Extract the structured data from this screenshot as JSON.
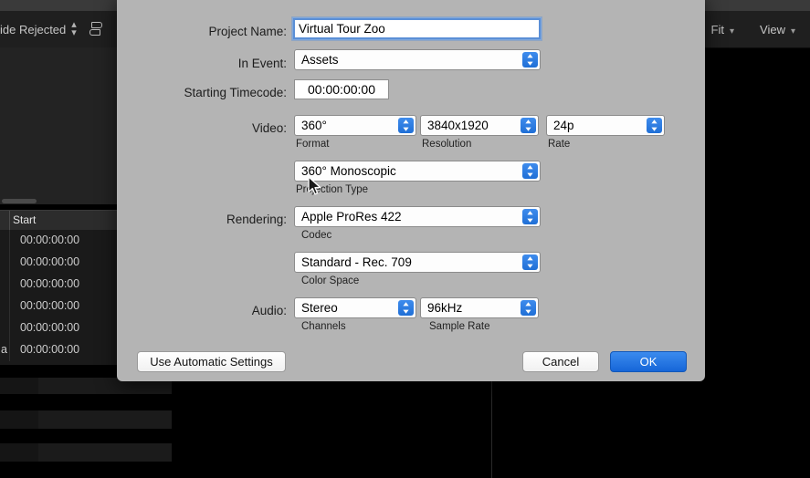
{
  "background": {
    "toolbar": {
      "hide_rejected_label": "ide Rejected",
      "stepper_icon": "stepper-updown-icon",
      "group_icon": "group-clips-icon",
      "fit_label": "Fit",
      "view_label": "View",
      "chevron_icon": "chevron-down-icon"
    },
    "event_list": {
      "column_header": "Start",
      "rows": [
        {
          "prefix": "",
          "start": "00:00:00:00"
        },
        {
          "prefix": "",
          "start": "00:00:00:00"
        },
        {
          "prefix": "",
          "start": "00:00:00:00"
        },
        {
          "prefix": "",
          "start": "00:00:00:00"
        },
        {
          "prefix": "",
          "start": "00:00:00:00"
        },
        {
          "prefix": "a",
          "start": "00:00:00:00"
        }
      ]
    }
  },
  "dialog": {
    "project_name": {
      "label": "Project Name:",
      "value": "Virtual Tour Zoo"
    },
    "in_event": {
      "label": "In Event:",
      "value": "Assets"
    },
    "starting_timecode": {
      "label": "Starting Timecode:",
      "value": "00:00:00:00"
    },
    "video": {
      "label": "Video:",
      "format": {
        "value": "360°",
        "sublabel": "Format"
      },
      "resolution": {
        "value": "3840x1920",
        "sublabel": "Resolution"
      },
      "rate": {
        "value": "24p",
        "sublabel": "Rate"
      },
      "projection": {
        "value": "360° Monoscopic",
        "sublabel": "Projection Type"
      }
    },
    "rendering": {
      "label": "Rendering:",
      "codec": {
        "value": "Apple ProRes 422",
        "sublabel": "Codec"
      },
      "color_space": {
        "value": "Standard - Rec. 709",
        "sublabel": "Color Space"
      }
    },
    "audio": {
      "label": "Audio:",
      "channels": {
        "value": "Stereo",
        "sublabel": "Channels"
      },
      "sample_rate": {
        "value": "96kHz",
        "sublabel": "Sample Rate"
      }
    },
    "buttons": {
      "auto": "Use Automatic Settings",
      "cancel": "Cancel",
      "ok": "OK"
    },
    "colors": {
      "dialog_bg": "#b4b4b4",
      "accent_blue": "#1f6fd6",
      "focus_ring": "#5b8fd6"
    }
  }
}
